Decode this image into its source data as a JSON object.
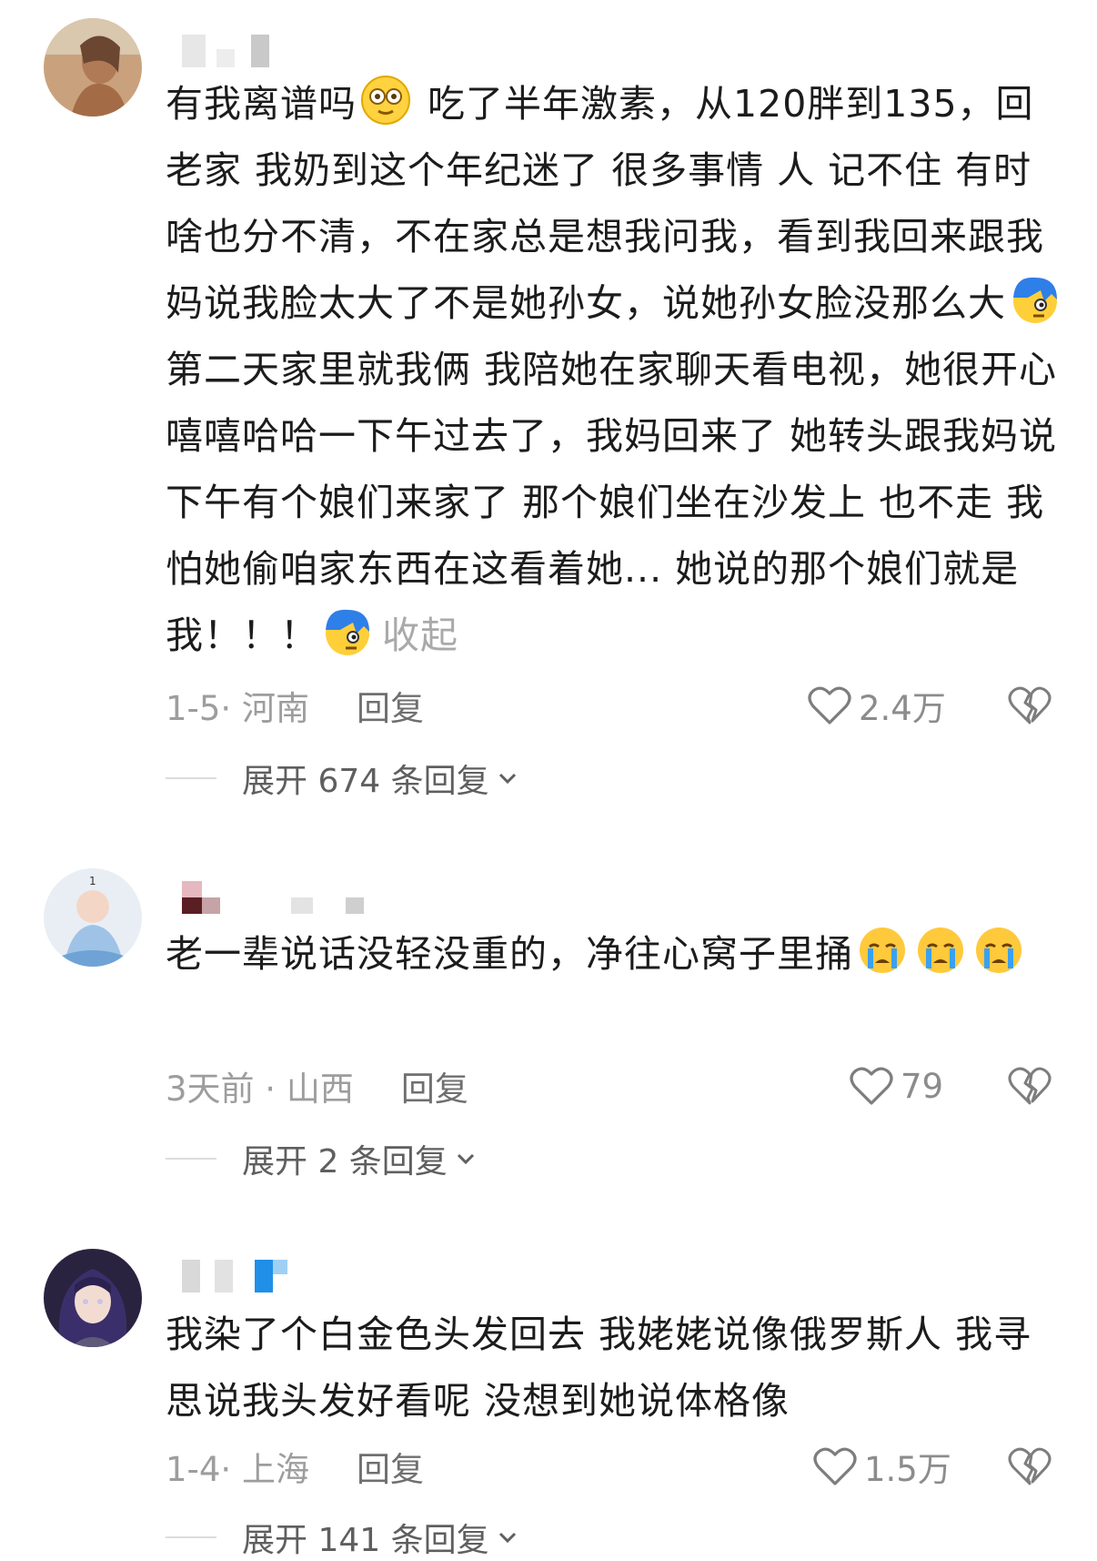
{
  "comments": [
    {
      "text_a": "有我离谱吗",
      "text_b": " 吃了半年激素，从120胖到135，回老家 我奶到这个年纪迷了 很多事情 人 记不住 有时啥也分不清，不在家总是想我问我，看到我回来跟我妈说我脸太大了不是她孙女，说她孙女脸没那么大",
      "text_c": " 第二天家里就我俩 我陪她在家聊天看电视，她很开心 嘻嘻哈哈一下午过去了，我妈回来了 她转头跟我妈说 下午有个娘们来家了 那个娘们坐在沙发上 也不走 我怕她偷咱家东西在这看着她... 她说的那个娘们就是我！！！",
      "collapse": "收起",
      "date_location": "1-5· 河南",
      "reply": "回复",
      "likes": "2.4万",
      "expand": "展开 674 条回复"
    },
    {
      "text": "老一辈说话没轻没重的，净往心窝子里捅",
      "date_location": "3天前 · 山西",
      "reply": "回复",
      "likes": "79",
      "expand": "展开 2 条回复"
    },
    {
      "text": "我染了个白金色头发回去 我姥姥说像俄罗斯人 我寻思说我头发好看呢 没想到她说体格像",
      "date_location": "1-4· 上海",
      "reply": "回复",
      "likes": "1.5万",
      "expand": "展开 141 条回复"
    }
  ],
  "icons": {
    "like": "heart-outline-icon",
    "dislike": "broken-heart-icon",
    "expand": "chevron-down-icon",
    "emoji_1": "dizzy-face-emoji",
    "emoji_2": "blue-hair-awkward-emoji",
    "emoji_3": "crying-face-emoji"
  }
}
